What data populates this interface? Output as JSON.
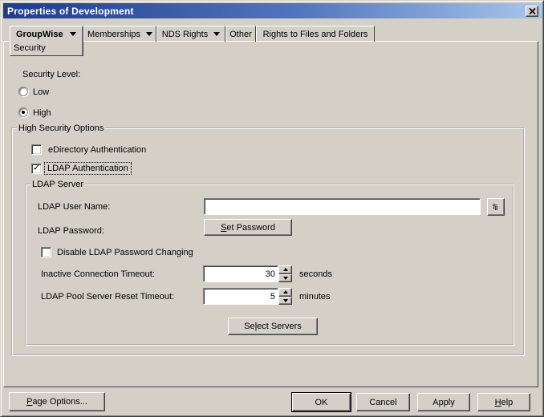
{
  "window": {
    "title": "Properties of Development"
  },
  "tabs": [
    {
      "label": "GroupWise",
      "sub_label": "Security",
      "has_menu": true,
      "active": true
    },
    {
      "label": "Memberships",
      "has_menu": true
    },
    {
      "label": "NDS Rights",
      "has_menu": true
    },
    {
      "label": "Other",
      "has_menu": false
    },
    {
      "label": "Rights to Files and Folders",
      "has_menu": false
    }
  ],
  "security": {
    "level_label": "Security Level:",
    "low_label": "Low",
    "high_label": "High",
    "selected": "High"
  },
  "high_options": {
    "title": "High Security Options",
    "edirectory_label": "eDirectory Authentication",
    "edirectory_checked": false,
    "ldap_label": "LDAP Authentication",
    "ldap_checked": true
  },
  "ldap_server": {
    "title": "LDAP Server",
    "user_name_label": "LDAP User Name:",
    "user_name_value": "",
    "password_label": "LDAP Password:",
    "set_password": {
      "mn": "S",
      "post": "et Password"
    },
    "disable_label": "Disable LDAP Password Changing",
    "disable_checked": false,
    "inactive_timeout": {
      "label": "Inactive Connection Timeout:",
      "value": "30",
      "unit": "seconds"
    },
    "pool_timeout": {
      "label": "LDAP Pool Server Reset Timeout:",
      "value": "5",
      "unit": "minutes"
    },
    "select_servers": {
      "pre": "Se",
      "mn": "l",
      "post": "ect Servers"
    }
  },
  "footer": {
    "page_options": {
      "mn": "P",
      "post": "age Options..."
    },
    "ok": "OK",
    "cancel": "Cancel",
    "apply": "Apply",
    "help": {
      "mn": "H",
      "post": "elp"
    }
  },
  "glyphs": {
    "check": "✓"
  },
  "colors": {
    "face": "#d4d0c8",
    "titlebar_left": "#1f3b8d",
    "titlebar_right": "#a8c6ec",
    "shadow_dark": "#404040",
    "shadow_mid": "#808080"
  }
}
